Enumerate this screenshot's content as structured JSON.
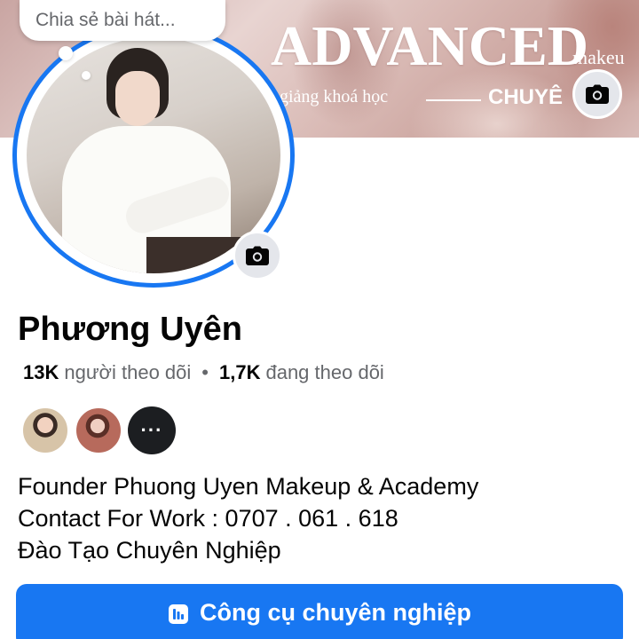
{
  "cover": {
    "title": "ADVANCED",
    "title_suffix": "makeu",
    "subtitle": "giảng khoá học",
    "subtitle_right": "CHUYÊ",
    "camera_icon": "camera-icon"
  },
  "status_bubble": {
    "placeholder": "Chia sẻ bài hát..."
  },
  "profile": {
    "name": "Phương Uyên",
    "followers_count": "13K",
    "followers_label": "người theo dõi",
    "separator": "•",
    "following_count": "1,7K",
    "following_label": "đang theo dõi",
    "more_friends_label": "···"
  },
  "bio": {
    "lines": [
      "Founder Phuong Uyen Makeup & Academy",
      "Contact For Work : 0707 . 061 . 618",
      "Đào Tạo Chuyên Nghiệp"
    ]
  },
  "actions": {
    "professional_tools_label": "Công cụ chuyên nghiệp",
    "professional_tools_icon": "dashboard-icon"
  },
  "colors": {
    "accent": "#1877f2",
    "secondary_text": "#65676b",
    "icon_bg": "#e4e6eb"
  }
}
